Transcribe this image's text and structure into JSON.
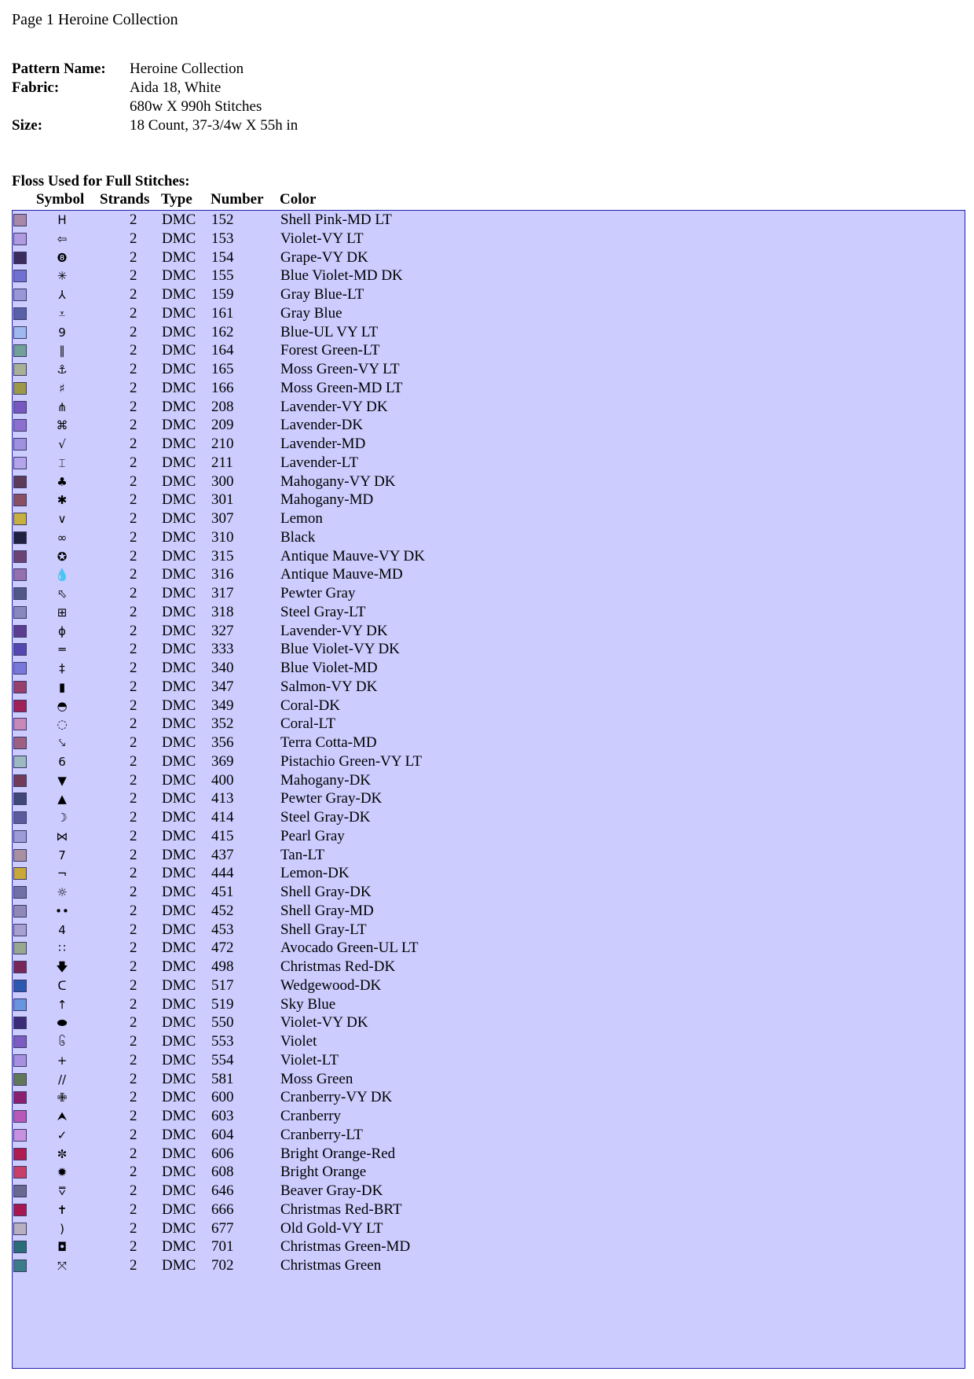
{
  "page_header": "Page 1  Heroine Collection",
  "info": [
    {
      "label": "Pattern Name:",
      "value": "Heroine Collection"
    },
    {
      "label": "Fabric:",
      "value": "Aida 18, White"
    },
    {
      "label": "",
      "value": "680w X 990h Stitches"
    },
    {
      "label": "Size:",
      "value": "18 Count,   37-3/4w X 55h in"
    }
  ],
  "section_title": "Floss Used for Full Stitches:",
  "columns": {
    "symbol": "Symbol",
    "strands": "Strands",
    "type": "Type",
    "number": "Number",
    "color": "Color"
  },
  "floss": [
    {
      "color": "#a888a8",
      "symbol": "ᕼ",
      "strands": "2",
      "type": "DMC",
      "number": "152",
      "name": "Shell Pink-MD LT"
    },
    {
      "color": "#b09ae0",
      "symbol": "⇦",
      "strands": "2",
      "type": "DMC",
      "number": "153",
      "name": "Violet-VY LT"
    },
    {
      "color": "#3c2c5c",
      "symbol": "❽",
      "strands": "2",
      "type": "DMC",
      "number": "154",
      "name": "Grape-VY DK"
    },
    {
      "color": "#7070d0",
      "symbol": "✳",
      "strands": "2",
      "type": "DMC",
      "number": "155",
      "name": "Blue Violet-MD DK"
    },
    {
      "color": "#9898d8",
      "symbol": "⅄",
      "strands": "2",
      "type": "DMC",
      "number": "159",
      "name": "Gray Blue-LT"
    },
    {
      "color": "#5860a8",
      "symbol": "⩡",
      "strands": "2",
      "type": "DMC",
      "number": "161",
      "name": "Gray Blue"
    },
    {
      "color": "#a0b8f0",
      "symbol": "𝟫",
      "strands": "2",
      "type": "DMC",
      "number": "162",
      "name": "Blue-UL VY LT"
    },
    {
      "color": "#70a098",
      "symbol": "∥",
      "strands": "2",
      "type": "DMC",
      "number": "164",
      "name": "Forest Green-LT"
    },
    {
      "color": "#a8b098",
      "symbol": "⚓",
      "strands": "2",
      "type": "DMC",
      "number": "165",
      "name": "Moss Green-VY LT"
    },
    {
      "color": "#9c9848",
      "symbol": "♯",
      "strands": "2",
      "type": "DMC",
      "number": "166",
      "name": "Moss Green-MD LT"
    },
    {
      "color": "#7858c0",
      "symbol": "⋔",
      "strands": "2",
      "type": "DMC",
      "number": "208",
      "name": "Lavender-VY DK"
    },
    {
      "color": "#8c70d0",
      "symbol": "⌘",
      "strands": "2",
      "type": "DMC",
      "number": "209",
      "name": "Lavender-DK"
    },
    {
      "color": "#a090e0",
      "symbol": "√",
      "strands": "2",
      "type": "DMC",
      "number": "210",
      "name": "Lavender-MD"
    },
    {
      "color": "#b4a4ec",
      "symbol": "⌶",
      "strands": "2",
      "type": "DMC",
      "number": "211",
      "name": "Lavender-LT"
    },
    {
      "color": "#5c3c58",
      "symbol": "♣",
      "strands": "2",
      "type": "DMC",
      "number": "300",
      "name": "Mahogany-VY DK"
    },
    {
      "color": "#885060",
      "symbol": "✱",
      "strands": "2",
      "type": "DMC",
      "number": "301",
      "name": "Mahogany-MD"
    },
    {
      "color": "#c8b040",
      "symbol": "∨",
      "strands": "2",
      "type": "DMC",
      "number": "307",
      "name": "Lemon"
    },
    {
      "color": "#202040",
      "symbol": "∞",
      "strands": "2",
      "type": "DMC",
      "number": "310",
      "name": "Black"
    },
    {
      "color": "#6c4474",
      "symbol": "✪",
      "strands": "2",
      "type": "DMC",
      "number": "315",
      "name": "Antique Mauve-VY DK"
    },
    {
      "color": "#9470b0",
      "symbol": "💧",
      "strands": "2",
      "type": "DMC",
      "number": "316",
      "name": "Antique Mauve-MD"
    },
    {
      "color": "#505888",
      "symbol": "⬁",
      "strands": "2",
      "type": "DMC",
      "number": "317",
      "name": "Pewter Gray"
    },
    {
      "color": "#8888c0",
      "symbol": "⊞",
      "strands": "2",
      "type": "DMC",
      "number": "318",
      "name": "Steel Gray-LT"
    },
    {
      "color": "#5c3c90",
      "symbol": "ɸ",
      "strands": "2",
      "type": "DMC",
      "number": "327",
      "name": "Lavender-VY DK"
    },
    {
      "color": "#5448b0",
      "symbol": "═",
      "strands": "2",
      "type": "DMC",
      "number": "333",
      "name": "Blue Violet-VY DK"
    },
    {
      "color": "#7878d8",
      "symbol": "‡",
      "strands": "2",
      "type": "DMC",
      "number": "340",
      "name": "Blue Violet-MD"
    },
    {
      "color": "#98406c",
      "symbol": "▮",
      "strands": "2",
      "type": "DMC",
      "number": "347",
      "name": "Salmon-VY DK"
    },
    {
      "color": "#a02058",
      "symbol": "◓",
      "strands": "2",
      "type": "DMC",
      "number": "349",
      "name": "Coral-DK"
    },
    {
      "color": "#c888b8",
      "symbol": "◌",
      "strands": "2",
      "type": "DMC",
      "number": "352",
      "name": "Coral-LT"
    },
    {
      "color": "#9c6080",
      "symbol": "⤥",
      "strands": "2",
      "type": "DMC",
      "number": "356",
      "name": "Terra Cotta-MD"
    },
    {
      "color": "#9cb8c0",
      "symbol": "𝟨",
      "strands": "2",
      "type": "DMC",
      "number": "369",
      "name": "Pistachio Green-VY LT"
    },
    {
      "color": "#703c58",
      "symbol": "▼",
      "strands": "2",
      "type": "DMC",
      "number": "400",
      "name": "Mahogany-DK"
    },
    {
      "color": "#404878",
      "symbol": "▲",
      "strands": "2",
      "type": "DMC",
      "number": "413",
      "name": "Pewter Gray-DK"
    },
    {
      "color": "#5c5c9c",
      "symbol": "☽",
      "strands": "2",
      "type": "DMC",
      "number": "414",
      "name": "Steel Gray-DK"
    },
    {
      "color": "#9c9cd8",
      "symbol": "⋈",
      "strands": "2",
      "type": "DMC",
      "number": "415",
      "name": "Pearl Gray"
    },
    {
      "color": "#a890a0",
      "symbol": "𝟩",
      "strands": "2",
      "type": "DMC",
      "number": "437",
      "name": "Tan-LT"
    },
    {
      "color": "#c8a838",
      "symbol": "¬",
      "strands": "2",
      "type": "DMC",
      "number": "444",
      "name": "Lemon-DK"
    },
    {
      "color": "#7070a8",
      "symbol": "☼",
      "strands": "2",
      "type": "DMC",
      "number": "451",
      "name": "Shell Gray-DK"
    },
    {
      "color": "#9088b8",
      "symbol": "••",
      "strands": "2",
      "type": "DMC",
      "number": "452",
      "name": "Shell Gray-MD"
    },
    {
      "color": "#a8a0d0",
      "symbol": "𝟦",
      "strands": "2",
      "type": "DMC",
      "number": "453",
      "name": "Shell Gray-LT"
    },
    {
      "color": "#98a890",
      "symbol": "∷",
      "strands": "2",
      "type": "DMC",
      "number": "472",
      "name": "Avocado Green-UL LT"
    },
    {
      "color": "#782858",
      "symbol": "🡇",
      "strands": "2",
      "type": "DMC",
      "number": "498",
      "name": "Christmas Red-DK"
    },
    {
      "color": "#2c58b0",
      "symbol": "ᑕ",
      "strands": "2",
      "type": "DMC",
      "number": "517",
      "name": "Wedgewood-DK"
    },
    {
      "color": "#6894e0",
      "symbol": "↑",
      "strands": "2",
      "type": "DMC",
      "number": "519",
      "name": "Sky Blue"
    },
    {
      "color": "#3c2c78",
      "symbol": "⬬",
      "strands": "2",
      "type": "DMC",
      "number": "550",
      "name": "Violet-VY DK"
    },
    {
      "color": "#7c5cc0",
      "symbol": "၆",
      "strands": "2",
      "type": "DMC",
      "number": "553",
      "name": "Violet"
    },
    {
      "color": "#a890e0",
      "symbol": "+",
      "strands": "2",
      "type": "DMC",
      "number": "554",
      "name": "Violet-LT"
    },
    {
      "color": "#607858",
      "symbol": "//",
      "strands": "2",
      "type": "DMC",
      "number": "581",
      "name": "Moss Green"
    },
    {
      "color": "#8c2070",
      "symbol": "✙",
      "strands": "2",
      "type": "DMC",
      "number": "600",
      "name": "Cranberry-VY DK"
    },
    {
      "color": "#b858b8",
      "symbol": "⮝",
      "strands": "2",
      "type": "DMC",
      "number": "603",
      "name": "Cranberry"
    },
    {
      "color": "#c890e0",
      "symbol": "✓",
      "strands": "2",
      "type": "DMC",
      "number": "604",
      "name": "Cranberry-LT"
    },
    {
      "color": "#b01c50",
      "symbol": "✼",
      "strands": "2",
      "type": "DMC",
      "number": "606",
      "name": "Bright Orange-Red"
    },
    {
      "color": "#c84068",
      "symbol": "✹",
      "strands": "2",
      "type": "DMC",
      "number": "608",
      "name": "Bright Orange"
    },
    {
      "color": "#686890",
      "symbol": "⩢",
      "strands": "2",
      "type": "DMC",
      "number": "646",
      "name": "Beaver Gray-DK"
    },
    {
      "color": "#a81850",
      "symbol": "✝",
      "strands": "2",
      "type": "DMC",
      "number": "666",
      "name": "Christmas Red-BRT"
    },
    {
      "color": "#b8b0c0",
      "symbol": ")",
      "strands": "2",
      "type": "DMC",
      "number": "677",
      "name": "Old Gold-VY LT"
    },
    {
      "color": "#2c6c78",
      "symbol": "◘",
      "strands": "2",
      "type": "DMC",
      "number": "701",
      "name": "Christmas Green-MD"
    },
    {
      "color": "#3c7c88",
      "symbol": "⤧",
      "strands": "2",
      "type": "DMC",
      "number": "702",
      "name": "Christmas Green"
    }
  ]
}
